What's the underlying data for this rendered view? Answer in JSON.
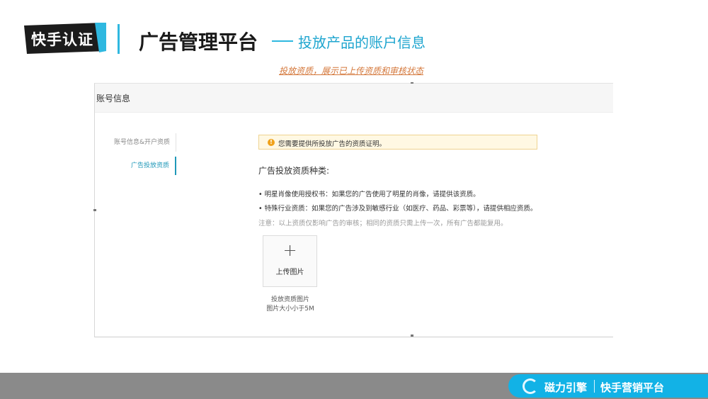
{
  "header": {
    "logo_text": "快手认证",
    "title": "广告管理平台",
    "subtitle": "投放产品的账户信息",
    "caption": "投放资质，展示已上传资质和审核状态"
  },
  "screenshot": {
    "account_header": "账号信息",
    "side_nav": [
      {
        "label": "账号信息&开户资质",
        "active": false
      },
      {
        "label": "广告投放资质",
        "active": true
      }
    ],
    "alert": {
      "icon": "warning-icon",
      "text": "您需要提供所投放广告的资质证明。"
    },
    "section_title": "广告投放资质种类:",
    "bullets": [
      "• 明星肖像使用授权书：如果您的广告使用了明星的肖像，请提供该资质。",
      "• 特殊行业资质：如果您的广告涉及到敏感行业（如医疗、药品、彩票等），请提供相应资质。"
    ],
    "note": "注意：以上资质仅影响广告的审核；相同的资质只需上传一次，所有广告都能复用。",
    "upload": {
      "plus": "+",
      "label": "上传图片",
      "tip_line1": "投放资质图片",
      "tip_line2": "图片大小小于5M"
    }
  },
  "footer": {
    "brand": "磁力引擎",
    "platform": "快手营销平台"
  },
  "colors": {
    "accent": "#2fb8e0",
    "subtitle": "#1ea5cf",
    "caption": "#d4773a",
    "footer_pill": "#12b2e6",
    "footer_bar": "#8a8a8a",
    "alert_bg": "#fff8e3",
    "nav_active": "#1f98b8"
  }
}
